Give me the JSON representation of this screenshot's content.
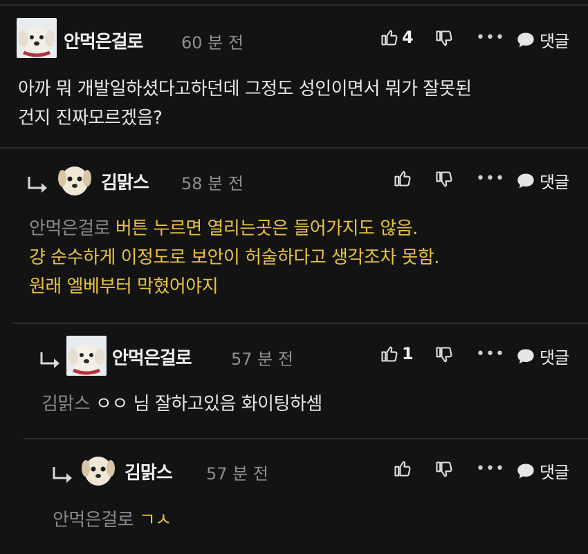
{
  "comments": [
    {
      "author": "안먹은걸로",
      "time": "60 분 전",
      "likes": "4",
      "reply_label": "댓글",
      "more": "•••",
      "lines": [
        "아까 뭐 개발일하셨다고하던데 그정도 성인이면서 뭐가 잘못된",
        "건지 진짜모르겠음?"
      ]
    },
    {
      "author": "김맑스",
      "time": "58 분 전",
      "likes": "",
      "reply_label": "댓글",
      "more": "•••",
      "mention": "안먹은걸로",
      "lines": [
        "버튼 누르면 열리는곳은 들어가지도 않음.",
        "걍 순수하게 이정도로 보안이 허술하다고 생각조차 못함.",
        "원래 엘베부터 막혔어야지"
      ]
    },
    {
      "author": "안먹은걸로",
      "time": "57 분 전",
      "likes": "1",
      "reply_label": "댓글",
      "more": "•••",
      "mention": "김맑스",
      "lines": [
        "ㅇㅇ 님 잘하고있음 화이팅하셈"
      ]
    },
    {
      "author": "김맑스",
      "time": "57 분 전",
      "likes": "",
      "reply_label": "댓글",
      "more": "•••",
      "mention": "안먹은걸로",
      "lines": [
        "ㄱㅅ"
      ]
    }
  ],
  "icons": {
    "like": "thumbs-up-icon",
    "dislike": "thumbs-down-icon",
    "more": "more-dots-icon",
    "reply": "speech-bubble-icon",
    "nest": "reply-arrow-icon"
  },
  "colors": {
    "background": "#131313",
    "highlight": "#e8c33f",
    "mention": "#8a8a8a",
    "time": "#8f8f8f"
  }
}
